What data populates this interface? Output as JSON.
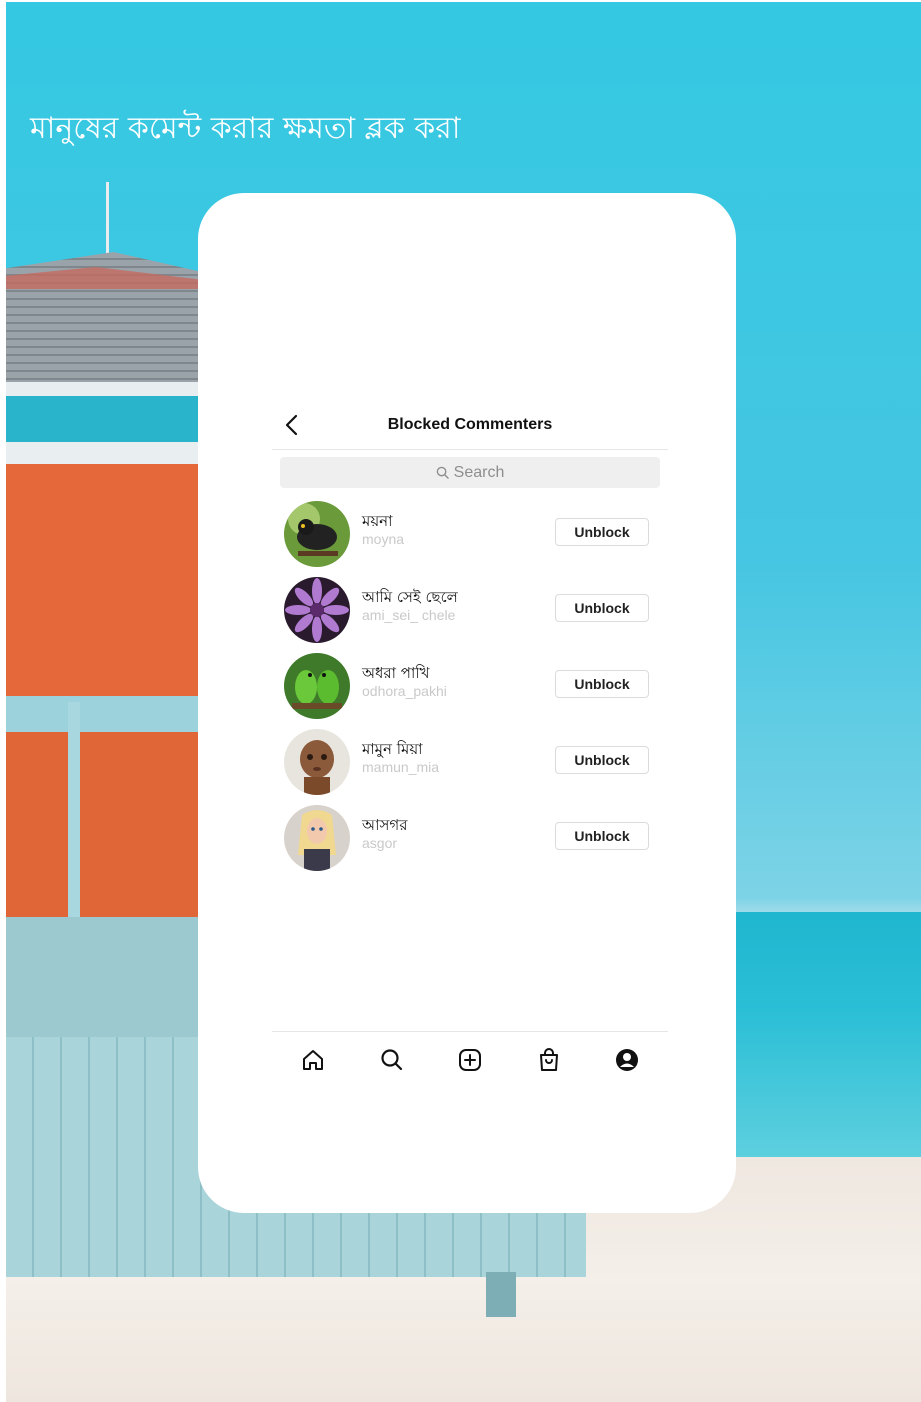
{
  "headline": "মানুষের কমেন্ট করার ক্ষমতা ব্লক করা",
  "screen": {
    "title": "Blocked Commenters",
    "back_icon": "chevron-left-icon",
    "search": {
      "placeholder": "Search",
      "icon": "search-icon"
    },
    "blocked_users": [
      {
        "name": "ময়না",
        "handle": "moyna",
        "avatar": "myna-bird-photo",
        "button": "Unblock"
      },
      {
        "name": "আমি সেই ছেলে",
        "handle": "ami_sei_ chele",
        "avatar": "purple-flower-photo",
        "button": "Unblock"
      },
      {
        "name": "অধরা পাখি",
        "handle": "odhora_pakhi",
        "avatar": "green-parrots-photo",
        "button": "Unblock"
      },
      {
        "name": "মামুন মিয়া",
        "handle": "mamun_mia",
        "avatar": "doll-photo",
        "button": "Unblock"
      },
      {
        "name": "আসগর",
        "handle": "asgor",
        "avatar": "barbie-doll-photo",
        "button": "Unblock"
      }
    ],
    "bottom_nav": [
      "home-icon",
      "search-icon",
      "add-post-icon",
      "shop-bag-icon",
      "profile-icon"
    ]
  },
  "colors": {
    "sky": "#34c8e2",
    "sea": "#1fb6cf",
    "hut_orange": "#e4683a",
    "card_bg": "#ffffff"
  }
}
